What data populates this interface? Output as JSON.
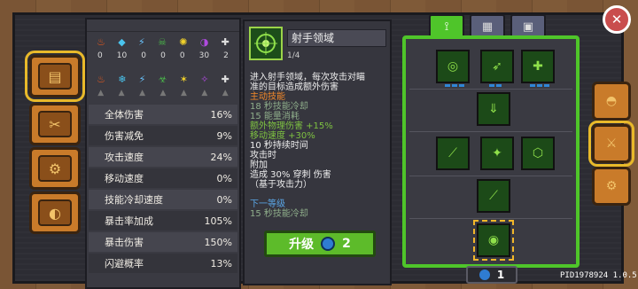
{
  "stats_panel": {
    "elements": [
      {
        "icon": "fire-icon",
        "color": "#ee5a1a",
        "value": "0"
      },
      {
        "icon": "ice-icon",
        "color": "#4ac4ee",
        "value": "10"
      },
      {
        "icon": "lightning-icon",
        "color": "#6ac4ff",
        "value": "0"
      },
      {
        "icon": "poison-icon",
        "color": "#4ab84a",
        "value": "0"
      },
      {
        "icon": "light-icon",
        "color": "#f2d22a",
        "value": "0"
      },
      {
        "icon": "dark-icon",
        "color": "#b04ae0",
        "value": "30"
      },
      {
        "icon": "physical-icon",
        "color": "#dddddd",
        "value": "2"
      }
    ],
    "effects_row": [
      "burn-icon",
      "freeze-icon",
      "shock-icon",
      "poison-effect-icon",
      "stun-icon",
      "curse-icon",
      "bleed-icon"
    ],
    "rows": [
      {
        "label": "全体伤害",
        "value": "16%"
      },
      {
        "label": "伤害减免",
        "value": "9%"
      },
      {
        "label": "攻击速度",
        "value": "24%"
      },
      {
        "label": "移动速度",
        "value": "0%"
      },
      {
        "label": "技能冷却速度",
        "value": "0%"
      },
      {
        "label": "暴击率加成",
        "value": "105%"
      },
      {
        "label": "暴击伤害",
        "value": "150%"
      },
      {
        "label": "闪避概率",
        "value": "13%"
      }
    ]
  },
  "skill": {
    "name": "射手领域",
    "level": "1/4",
    "desc_lines": [
      {
        "text": "进入射手领域，每次攻击对瞄",
        "cls": ""
      },
      {
        "text": "准的目标造成额外伤害",
        "cls": ""
      },
      {
        "text": "主动技能",
        "cls": "orange"
      },
      {
        "text": "18  秒技能冷却",
        "cls": "dim"
      },
      {
        "text": "15  能量消耗",
        "cls": "dim"
      },
      {
        "text": "额外物理伤害 +15%",
        "cls": "green"
      },
      {
        "text": "移动速度 +30%",
        "cls": "green"
      },
      {
        "text": "10  秒持续时间",
        "cls": ""
      },
      {
        "text": "攻击时",
        "cls": ""
      },
      {
        "text": "附加",
        "cls": ""
      },
      {
        "text": "造成 30% 穿刺 伤害",
        "cls": ""
      },
      {
        "text": "（基于攻击力）",
        "cls": ""
      },
      {
        "text": "",
        "cls": ""
      },
      {
        "text": "下一等级",
        "cls": "blue"
      },
      {
        "text": "15  秒技能冷却",
        "cls": "dim"
      }
    ],
    "upgrade_label": "升级",
    "upgrade_cost": "2"
  },
  "tree": {
    "tabs": [
      "bow-icon",
      "tab-two-icon",
      "tab-three-icon"
    ],
    "points": "1"
  },
  "pid": "PID1978924 1.0.5",
  "colors": {
    "accent_green": "#4fc52a",
    "tab_orange": "#c97b2a"
  }
}
